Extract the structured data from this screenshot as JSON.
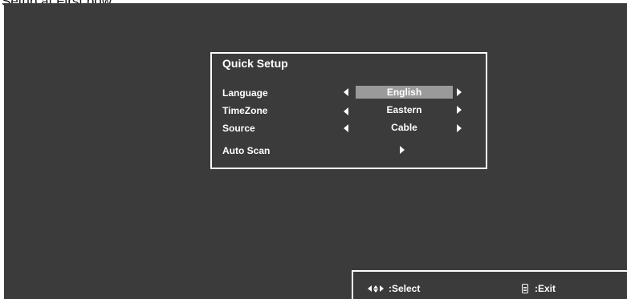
{
  "header": {
    "partial_text": "Setup at First pow"
  },
  "dialog": {
    "title": "Quick Setup",
    "rows": [
      {
        "label": "Language",
        "value": "English",
        "selected": true
      },
      {
        "label": "TimeZone",
        "value": "Eastern",
        "selected": false
      },
      {
        "label": "Source",
        "value": "Cable",
        "selected": false
      },
      {
        "label": "Auto Scan",
        "value": "",
        "selected": false
      }
    ]
  },
  "status_bar": {
    "select_label": ":Select",
    "exit_label": ":Exit",
    "select_icon": "arrow-keys-icon",
    "exit_icon": "remote-icon"
  },
  "colors": {
    "background": "#3b3b3b",
    "selected": "#9a9a9a",
    "text": "#ffffff"
  }
}
